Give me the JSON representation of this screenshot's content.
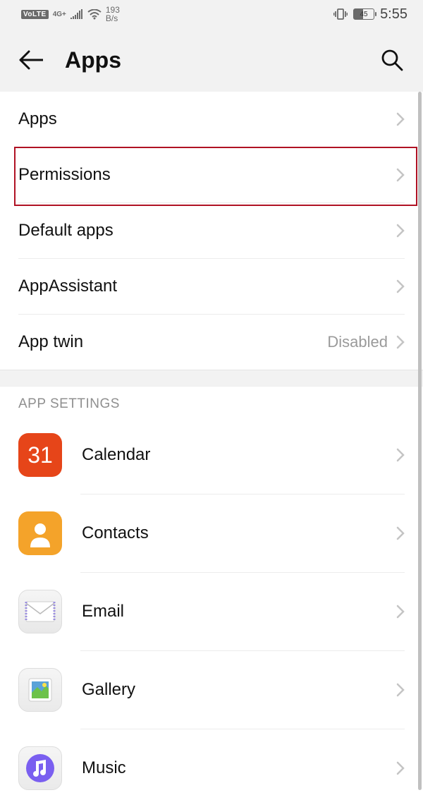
{
  "status": {
    "volte": "VoLTE",
    "net_gen": "4G+",
    "data_rate_value": "193",
    "data_rate_unit": "B/s",
    "battery_pct": "45",
    "time": "5:55"
  },
  "header": {
    "title": "Apps"
  },
  "menu": {
    "items": [
      {
        "label": "Apps",
        "value": ""
      },
      {
        "label": "Permissions",
        "value": ""
      },
      {
        "label": "Default apps",
        "value": ""
      },
      {
        "label": "AppAssistant",
        "value": ""
      },
      {
        "label": "App twin",
        "value": "Disabled"
      }
    ]
  },
  "section_title": "APP SETTINGS",
  "apps": [
    {
      "label": "Calendar",
      "icon": "calendar-icon",
      "day": "31"
    },
    {
      "label": "Contacts",
      "icon": "contacts-icon"
    },
    {
      "label": "Email",
      "icon": "email-icon"
    },
    {
      "label": "Gallery",
      "icon": "gallery-icon"
    },
    {
      "label": "Music",
      "icon": "music-icon"
    }
  ]
}
